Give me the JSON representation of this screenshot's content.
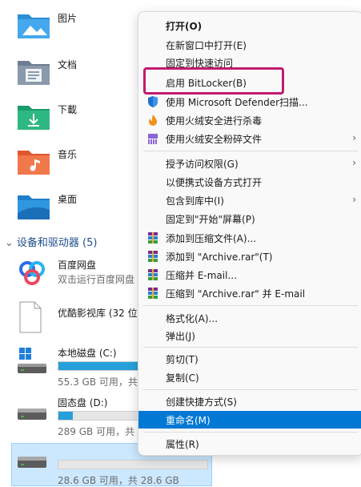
{
  "folders": [
    {
      "label": "图片"
    },
    {
      "label": "文档"
    },
    {
      "label": "下載"
    },
    {
      "label": "音乐"
    },
    {
      "label": "桌面"
    }
  ],
  "devices_header": "设备和驱动器 (5)",
  "devices": [
    {
      "name": "百度网盘",
      "sub": "双击运行百度网盘"
    },
    {
      "name": "优酷影视库 (32 位"
    },
    {
      "name": "本地磁盘 (C:)",
      "sub": "55.3 GB 可用，共",
      "usage": 0.75
    },
    {
      "name": "固态盘 (D:)",
      "sub": "289 GB 可用，共",
      "usage": 0.1
    },
    {
      "name": "",
      "sub": "28.6 GB 可用，共 28.6 GB",
      "usage": 0.0
    }
  ],
  "menu": {
    "items": [
      {
        "label": "打开(O)",
        "bold": true
      },
      {
        "label": "在新窗口中打开(E)"
      },
      {
        "label": "固定到快速访问"
      },
      {
        "label": "启用 BitLocker(B)"
      },
      {
        "label": "使用 Microsoft Defender扫描..."
      },
      {
        "label": "使用火绒安全进行杀毒"
      },
      {
        "label": "使用火绒安全粉碎文件"
      },
      {
        "label": "授予访问权限(G)"
      },
      {
        "label": "以便携式设备方式打开"
      },
      {
        "label": "包含到库中(I)"
      },
      {
        "label": "固定到\"开始\"屏幕(P)"
      },
      {
        "label": "添加到压缩文件(A)..."
      },
      {
        "label": "添加到 \"Archive.rar\"(T)"
      },
      {
        "label": "压缩并 E-mail..."
      },
      {
        "label": "压缩到 \"Archive.rar\" 并 E-mail"
      },
      {
        "label": "格式化(A)..."
      },
      {
        "label": "弹出(J)"
      },
      {
        "label": "剪切(T)"
      },
      {
        "label": "复制(C)"
      },
      {
        "label": "创建快捷方式(S)"
      },
      {
        "label": "重命名(M)"
      },
      {
        "label": "属性(R)"
      }
    ],
    "submenu_arrow": "›"
  },
  "colors": {
    "accent": "#0078d4",
    "highlight_box": "#c21a6e",
    "usage_bar": "#26a0da"
  }
}
